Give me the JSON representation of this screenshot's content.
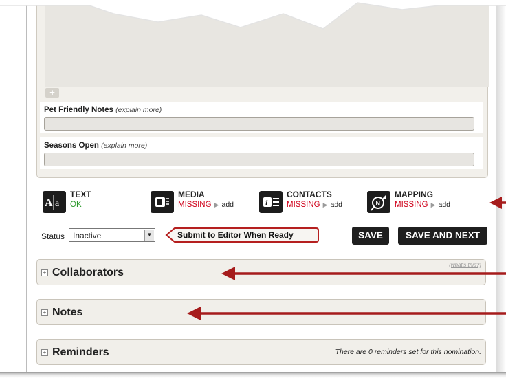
{
  "form": {
    "pet_friendly": {
      "label": "Pet Friendly Notes",
      "hint": "(explain more)"
    },
    "seasons_open": {
      "label": "Seasons Open",
      "hint": "(explain more)"
    },
    "add_symbol": "+"
  },
  "status_items": [
    {
      "icon": "text-icon",
      "title": "TEXT",
      "state": "OK",
      "state_color": "#2e9a2e"
    },
    {
      "icon": "media-icon",
      "title": "MEDIA",
      "state": "MISSING",
      "add": "add",
      "state_color": "#d0021b"
    },
    {
      "icon": "contacts-icon",
      "title": "CONTACTS",
      "state": "MISSING",
      "add": "add",
      "state_color": "#d0021b"
    },
    {
      "icon": "mapping-icon",
      "title": "MAPPING",
      "state": "MISSING",
      "add": "add",
      "state_color": "#d0021b"
    }
  ],
  "status": {
    "label": "Status",
    "value": "Inactive"
  },
  "actions": {
    "submit": "Submit to Editor When Ready",
    "save": "SAVE",
    "save_next": "SAVE AND NEXT"
  },
  "panels": {
    "collaborators": {
      "title": "Collaborators",
      "whats_this": "(what's this?)"
    },
    "notes": {
      "title": "Notes"
    },
    "reminders": {
      "title": "Reminders",
      "info": "There are 0 reminders set for this nomination."
    }
  },
  "colors": {
    "accent_arrow": "#a61c1c",
    "ok": "#2e9a2e",
    "missing": "#d0021b",
    "button_dark": "#1f1f1f"
  }
}
